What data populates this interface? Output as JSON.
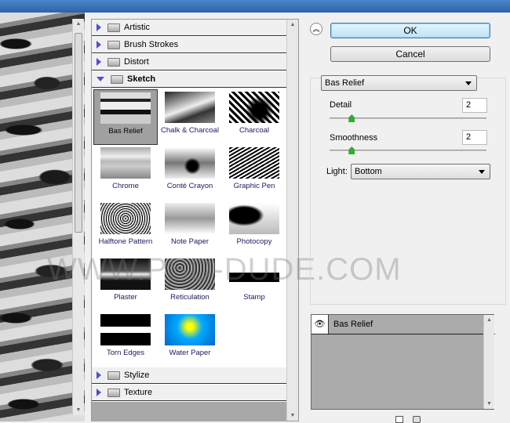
{
  "watermark": "WWW.PSD-DUDE.COM",
  "gallery": {
    "categories_top": [
      {
        "label": "Artistic"
      },
      {
        "label": "Brush Strokes"
      },
      {
        "label": "Distort"
      },
      {
        "label": "Sketch"
      }
    ],
    "filters": [
      {
        "label": "Bas Relief",
        "selected": true
      },
      {
        "label": "Chalk & Charcoal"
      },
      {
        "label": "Charcoal"
      },
      {
        "label": "Chrome"
      },
      {
        "label": "Conté Crayon"
      },
      {
        "label": "Graphic Pen"
      },
      {
        "label": "Halftone Pattern"
      },
      {
        "label": "Note Paper"
      },
      {
        "label": "Photocopy"
      },
      {
        "label": "Plaster"
      },
      {
        "label": "Reticulation"
      },
      {
        "label": "Stamp"
      },
      {
        "label": "Torn Edges"
      },
      {
        "label": "Water Paper"
      }
    ],
    "categories_bottom": [
      {
        "label": "Stylize"
      },
      {
        "label": "Texture"
      }
    ]
  },
  "buttons": {
    "ok": "OK",
    "cancel": "Cancel"
  },
  "settings": {
    "filter_select": "Bas Relief",
    "detail_label": "Detail",
    "detail_value": "2",
    "detail_range": [
      1,
      15
    ],
    "smoothness_label": "Smoothness",
    "smoothness_value": "2",
    "smoothness_range": [
      1,
      15
    ],
    "light_label": "Light:",
    "light_value": "Bottom"
  },
  "layers": {
    "items": [
      {
        "label": "Bas Relief",
        "visible": true
      }
    ]
  },
  "colors": {
    "ok_border": "#3c7fb1",
    "selected_thumb": "#a0a0a0",
    "layer_panel": "#aaaaaa"
  }
}
